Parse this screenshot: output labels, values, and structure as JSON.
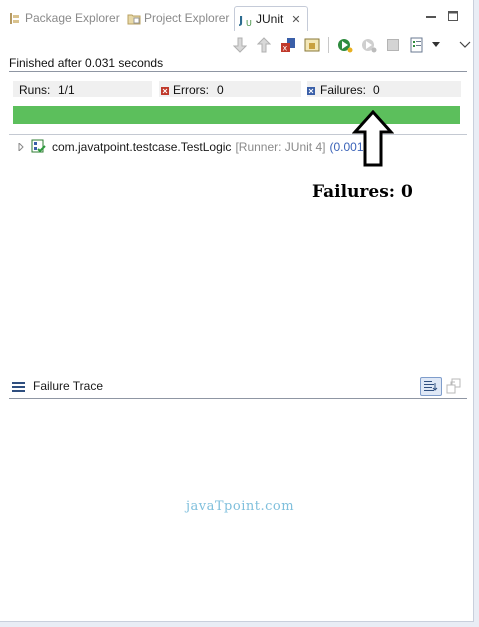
{
  "tabs": [
    {
      "label": "Package Explorer",
      "icon": "package-explorer-icon",
      "active": false
    },
    {
      "label": "Project Explorer",
      "icon": "project-explorer-icon",
      "active": false
    },
    {
      "label": "JUnit",
      "icon": "junit-icon",
      "active": true,
      "close": "✕"
    }
  ],
  "status": {
    "text": "Finished after 0.031 seconds"
  },
  "counters": {
    "runs_label": "Runs:",
    "runs_value": "1/1",
    "errors_label": "Errors:",
    "errors_value": "0",
    "failures_label": "Failures:",
    "failures_value": "0"
  },
  "progress": {
    "fraction": 1.0,
    "color": "#5cbf5c"
  },
  "tree": {
    "name": "com.javatpoint.testcase.TestLogic",
    "runner": "[Runner: JUnit 4]",
    "time": "(0.001 s"
  },
  "annotation": {
    "text": "Failures: 0"
  },
  "failure_trace": {
    "title": "Failure Trace"
  },
  "watermark": {
    "text": "javaTpoint.com"
  }
}
